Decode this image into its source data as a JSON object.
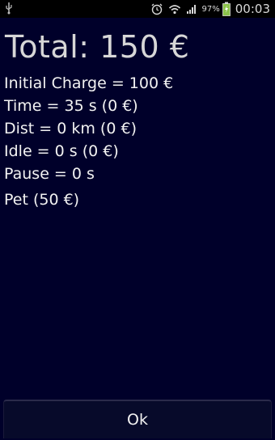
{
  "status_bar": {
    "left_icon": "usb-icon",
    "icons": [
      "alarm-icon",
      "wifi-icon",
      "signal-icon",
      "battery-icon"
    ],
    "battery_percent": "97%",
    "time": "00:03",
    "battery_color": "#8bc34a"
  },
  "summary": {
    "total": "Total: 150 €",
    "lines": [
      "Initial Charge = 100 €",
      "Time = 35 s (0 €)",
      "Dist = 0 km (0 €)",
      "Idle = 0 s (0 €)",
      "Pause = 0 s"
    ],
    "extra": "Pet (50 €)"
  },
  "actions": {
    "ok_label": "Ok"
  }
}
